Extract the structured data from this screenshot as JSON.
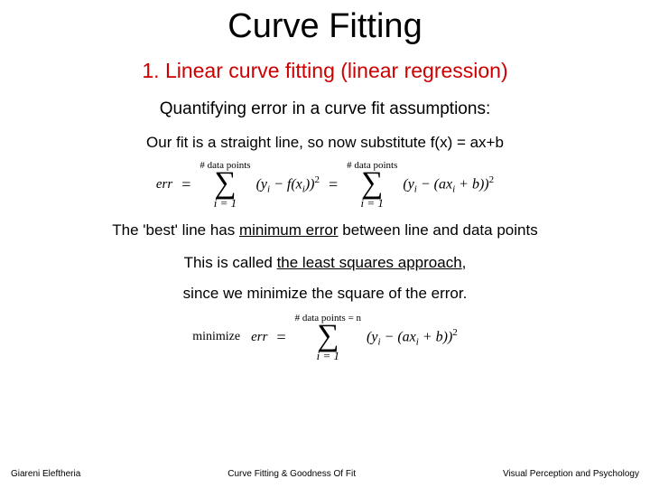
{
  "title": "Curve Fitting",
  "subtitle": "1. Linear curve fitting (linear regression)",
  "line1": "Quantifying error in a curve fit assumptions:",
  "line2": "Our fit is a straight line, so now substitute f(x) = ax+b",
  "eq1": {
    "err": "err",
    "eq": "=",
    "sum_top": "# data points",
    "sum_bot": "i = 1",
    "term1_a": "(y",
    "term1_b": " − f(x",
    "term1_c": "))",
    "term2_a": "(y",
    "term2_b": " − (ax",
    "term2_c": " + b))"
  },
  "line3_a": "The 'best' line has ",
  "line3_b": "minimum error",
  "line3_c": " between line and data points",
  "line4_a": "This is called ",
  "line4_b": "the least squares approach",
  "line4_c": ",",
  "line5": "since we minimize the square of the error.",
  "eq2": {
    "minimize": "minimize",
    "err": "err",
    "eq": "=",
    "sum_top": "# data points = n",
    "sum_bot": "i = 1",
    "term_a": "(y",
    "term_b": " − (ax",
    "term_c": " + b))"
  },
  "sup2": "2",
  "sub_i": "i",
  "footer": {
    "left": "Giareni Eleftheria",
    "center": "Curve Fitting & Goodness Of Fit",
    "right": "Visual Perception and Psychology"
  }
}
